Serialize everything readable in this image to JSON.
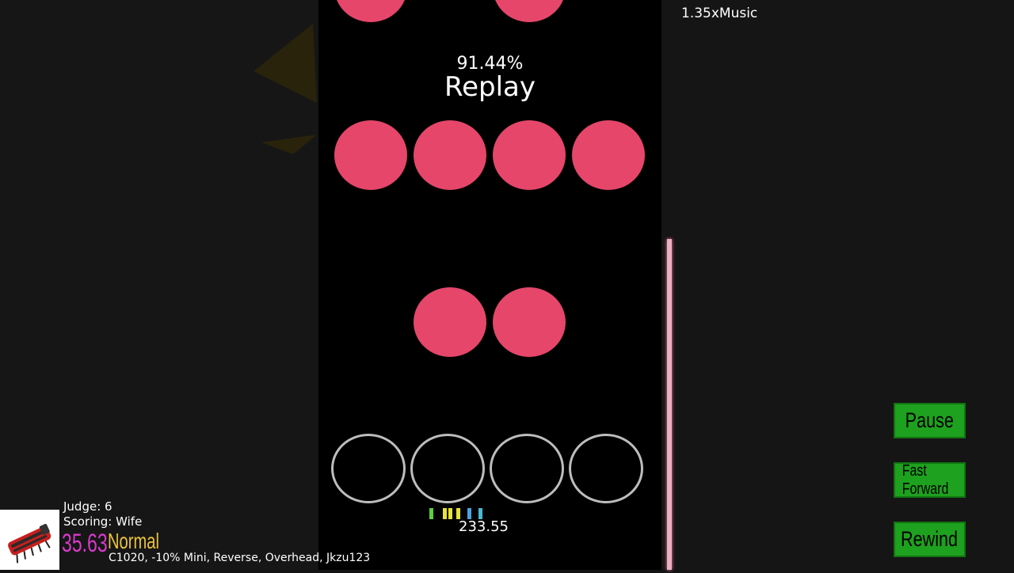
{
  "gameplay": {
    "accuracy": "91.44%",
    "mode_label": "Replay",
    "rate_label": "1.35xMusic",
    "current_score": "233.55"
  },
  "controls": {
    "pause_label": "Pause",
    "fast_forward_label": "Fast Forward",
    "rewind_label": "Rewind"
  },
  "player_info": {
    "judge": "Judge: 6",
    "scoring": "Scoring: Wife",
    "msd": "35.63",
    "difficulty": "Normal",
    "mods": "C1020, -10% Mini, Reverse, Overhead, Jkzu123"
  },
  "colors": {
    "note": "#e5466a",
    "receptor_outline": "#bdbdbd",
    "button_green": "#1ea11e",
    "msd_color": "#d63ac8",
    "difficulty_color": "#e8c23a"
  },
  "song_progress": 0.42
}
